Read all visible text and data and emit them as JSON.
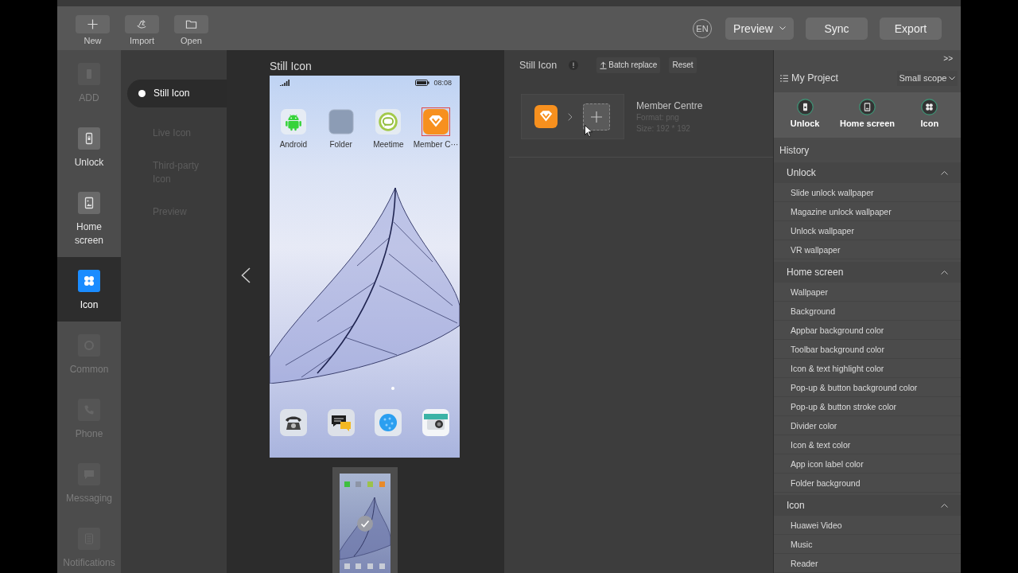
{
  "toolbar": {
    "file_buttons": [
      {
        "label": "New"
      },
      {
        "label": "Import"
      },
      {
        "label": "Open"
      }
    ],
    "language": "EN",
    "action_buttons": [
      {
        "label": "Preview",
        "kind": "dropdown"
      },
      {
        "label": "Sync",
        "kind": "button"
      },
      {
        "label": "Export",
        "kind": "button"
      }
    ]
  },
  "nav": [
    {
      "label": "ADD",
      "selected": false,
      "disabled": true
    },
    {
      "label": "Unlock",
      "selected": false,
      "disabled": false
    },
    {
      "label": "Home screen",
      "selected": false,
      "disabled": false
    },
    {
      "label": "Icon",
      "selected": true,
      "disabled": false
    },
    {
      "label": "Common",
      "selected": false,
      "disabled": true
    },
    {
      "label": "Phone",
      "selected": false,
      "disabled": true
    },
    {
      "label": "Messaging",
      "selected": false,
      "disabled": true
    },
    {
      "label": "Notifications",
      "selected": false,
      "disabled": true
    }
  ],
  "subnav": [
    {
      "label": "Still Icon",
      "selected": true,
      "disabled": false
    },
    {
      "label": "Live Icon",
      "selected": false,
      "disabled": true
    },
    {
      "label": "Third-party Icon",
      "selected": false,
      "disabled": true
    },
    {
      "label": "Preview",
      "selected": false,
      "disabled": true
    }
  ],
  "preview": {
    "title": "Still Icon",
    "status_time": "08:08",
    "apps": [
      {
        "label": "Android",
        "selected": false
      },
      {
        "label": "Folder",
        "selected": false
      },
      {
        "label": "Meetime",
        "selected": false
      },
      {
        "label": "Member C···",
        "selected": true
      }
    ],
    "thumbnails": [
      {
        "selected": true
      }
    ]
  },
  "editor": {
    "title": "Still Icon",
    "actions": [
      {
        "label": "Batch replace",
        "kind": "upload"
      },
      {
        "label": "Reset",
        "kind": "plain"
      }
    ],
    "item": {
      "name": "Member Centre",
      "format": "Format: png",
      "size": "Size: 192 * 192"
    }
  },
  "project": {
    "collapse": ">>",
    "title": "My Project",
    "scope": "Small scope",
    "tabs": [
      {
        "label": "Unlock"
      },
      {
        "label": "Home screen"
      },
      {
        "label": "Icon"
      }
    ],
    "history_title": "History",
    "groups": [
      {
        "label": "Unlock",
        "expanded": true,
        "items": [
          "Slide unlock wallpaper",
          "Magazine unlock wallpaper",
          "Unlock wallpaper",
          "VR wallpaper"
        ]
      },
      {
        "label": "Home screen",
        "expanded": true,
        "items": [
          "Wallpaper",
          "Background",
          "Appbar background color",
          "Toolbar background color",
          "Icon & text highlight color",
          "Pop-up & button background color",
          "Pop-up & button stroke color",
          "Divider color",
          "Icon & text color",
          "App icon label color",
          "Folder background"
        ]
      },
      {
        "label": "Icon",
        "expanded": true,
        "items": [
          "Huawei Video",
          "Music",
          "Reader"
        ]
      }
    ]
  }
}
